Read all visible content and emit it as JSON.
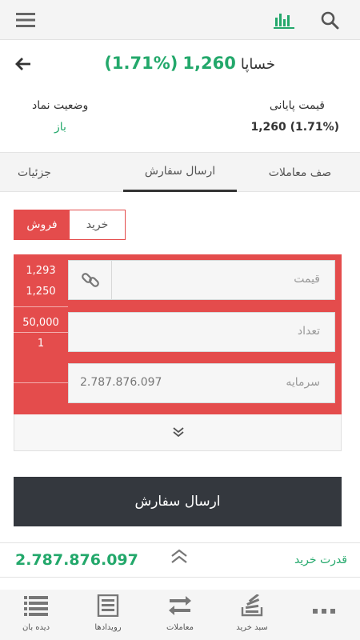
{
  "top_bar": {
    "icons": [
      "menu-icon",
      "bar-chart-icon",
      "search-icon"
    ],
    "accent_color": "#23a86b"
  },
  "symbol": {
    "name": "خساپا",
    "price": "1,260",
    "change": "(1.71%)",
    "color": "#23a86b"
  },
  "info": {
    "final_price_label": "قیمت پایانی",
    "final_price_value": "1,260 (1.71%)",
    "status_label": "وضعیت نماد",
    "status_value": "باز"
  },
  "tabs": [
    {
      "label": "صف معاملات",
      "active": false
    },
    {
      "label": "ارسال سفارش",
      "active": true
    },
    {
      "label": "جزئیات",
      "active": false
    }
  ],
  "side_toggle": {
    "buy_label": "خرید",
    "sell_label": "فروش",
    "selected": "sell",
    "sell_color": "#e44c4c"
  },
  "order_form": {
    "price_placeholder": "قیمت",
    "quantity_placeholder": "تعداد",
    "capital_placeholder": "سرمایه",
    "capital_value": "2.787.876.097",
    "price_max": "1,293",
    "price_min": "1,250",
    "quantity_max": "50,000",
    "quantity_min": "1"
  },
  "submit_label": "ارسال سفارش",
  "buying_power": {
    "label": "قدرت خرید",
    "amount": "2.787.876.097"
  },
  "bottom_nav": [
    {
      "label": "",
      "icon": "more-icon"
    },
    {
      "label": "سبد خرید",
      "icon": "stack-icon"
    },
    {
      "label": "معاملات",
      "icon": "swap-icon"
    },
    {
      "label": "رویدادها",
      "icon": "news-icon"
    },
    {
      "label": "دیده بان",
      "icon": "list-icon"
    }
  ]
}
